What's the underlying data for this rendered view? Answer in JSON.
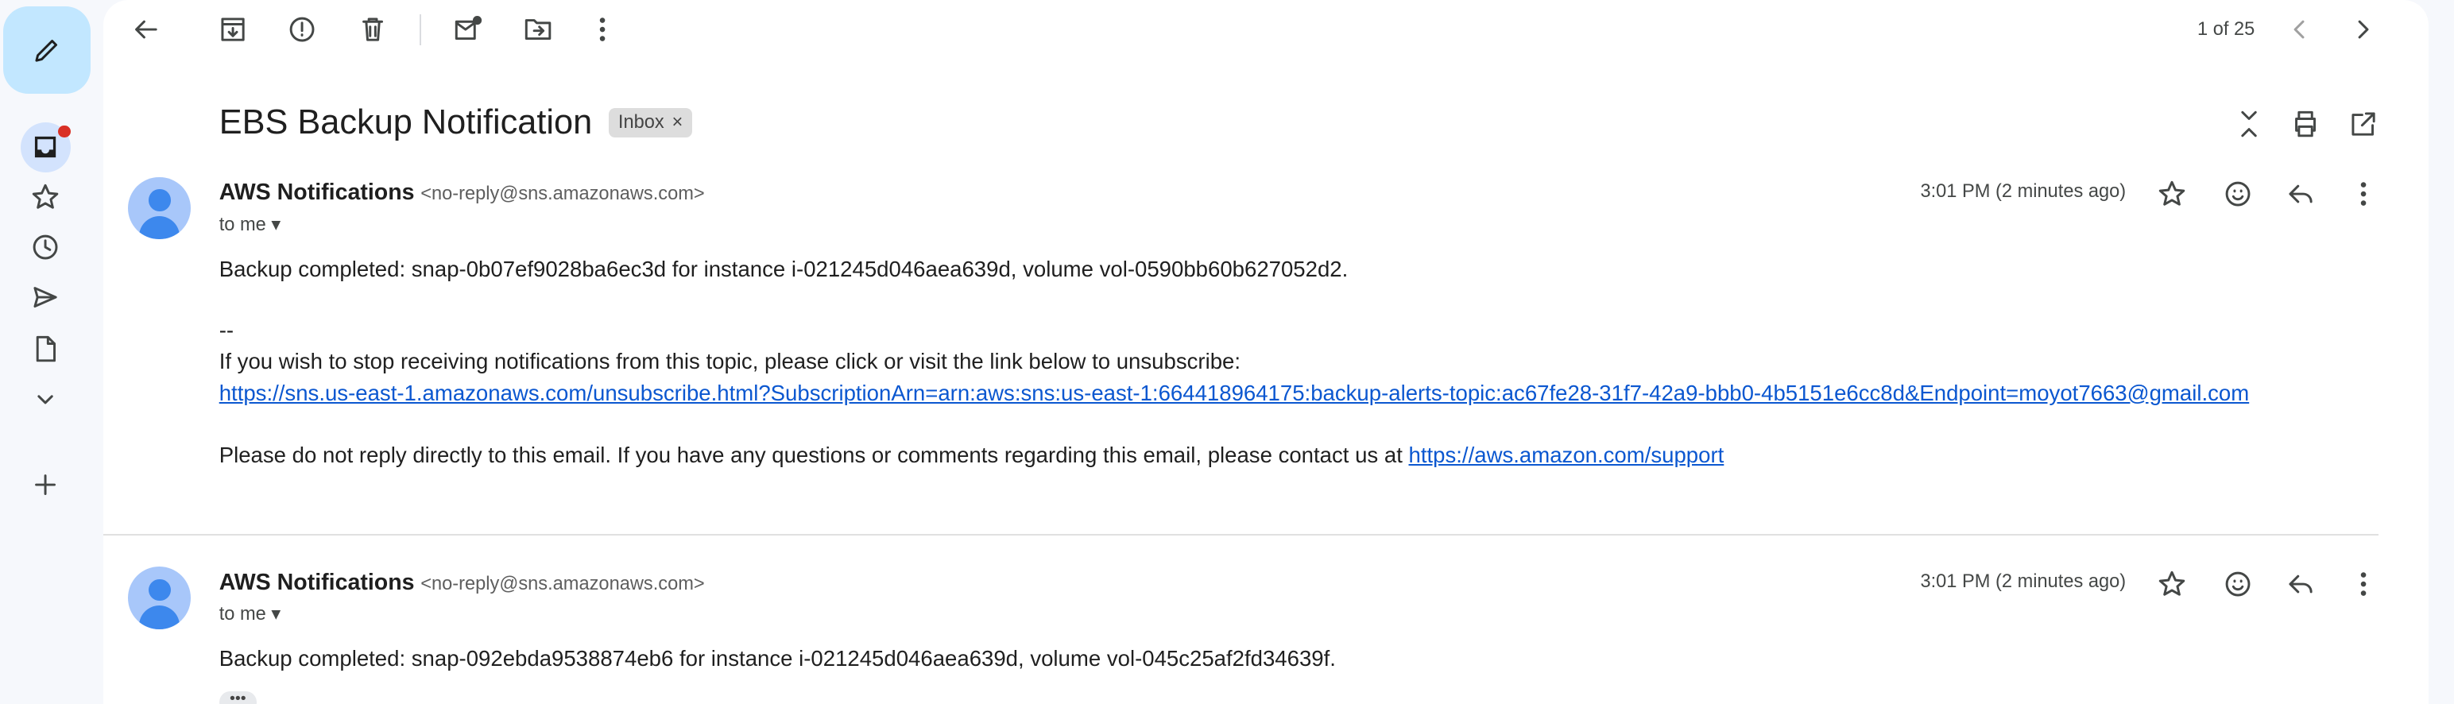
{
  "rail": {
    "items": [
      "compose",
      "inbox",
      "starred",
      "snoozed",
      "sent",
      "drafts",
      "more",
      "new-label"
    ]
  },
  "toolbar": {
    "pager": "1 of 25"
  },
  "thread": {
    "subject": "EBS Backup Notification",
    "label": "Inbox",
    "label_close": "×"
  },
  "messages": [
    {
      "sender": "AWS Notifications",
      "email": "<no-reply@sns.amazonaws.com>",
      "to": "to me",
      "time": "3:01 PM (2 minutes ago)",
      "body": "Backup completed: snap-0b07ef9028ba6ec3d for instance i-021245d046aea639d, volume vol-0590bb60b627052d2.",
      "sig": "--",
      "unsub_text": "If you wish to stop receiving notifications from this topic, please click or visit the link below to unsubscribe:",
      "unsub_link": "https://sns.us-east-1.amazonaws.com/unsubscribe.html?SubscriptionArn=arn:aws:sns:us-east-1:664418964175:backup-alerts-topic:ac67fe28-31f7-42a9-bbb0-4b5151e6cc8d&Endpoint=moyot7663@gmail.com",
      "footer_text": "Please do not reply directly to this email. If you have any questions or comments regarding this email, please contact us at ",
      "footer_link": "https://aws.amazon.com/support"
    },
    {
      "sender": "AWS Notifications",
      "email": "<no-reply@sns.amazonaws.com>",
      "to": "to me",
      "time": "3:01 PM (2 minutes ago)",
      "body": "Backup completed: snap-092ebda9538874eb6 for instance i-021245d046aea639d, volume vol-045c25af2fd34639f.",
      "trimmed": "•••"
    }
  ],
  "colors": {
    "compose": "#c2e7ff",
    "link": "#0b57d0",
    "unread_dot": "#d93025"
  }
}
